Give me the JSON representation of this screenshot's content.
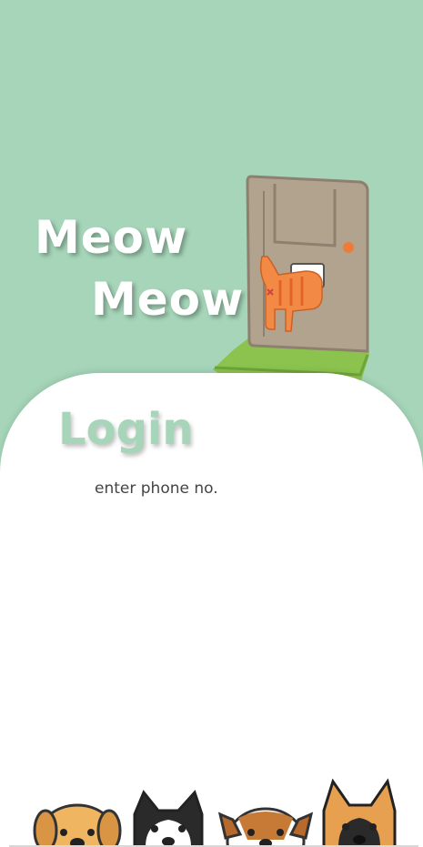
{
  "app": {
    "title_line1": "Meow",
    "title_line2": "Meow!"
  },
  "login": {
    "heading": "Login",
    "phone_placeholder": "enter phone no."
  },
  "illustrations": {
    "header": "cat-at-door-illustration",
    "footer": "peeking-dogs-illustration"
  },
  "colors": {
    "background": "#a6d5b9",
    "card": "#ffffff",
    "heading": "#a6d5b9",
    "text": "#444444"
  }
}
